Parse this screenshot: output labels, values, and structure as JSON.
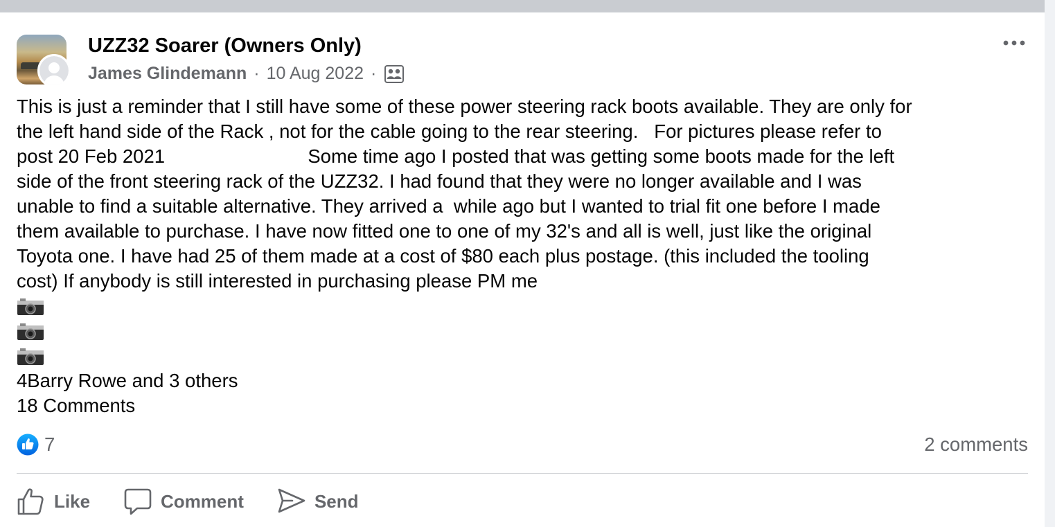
{
  "post": {
    "group_name": "UZZ32 Soarer (Owners Only)",
    "author": "James Glindemann",
    "separator": "·",
    "date": "10 Aug 2022",
    "audience_icon": "group-members-icon",
    "more_icon": "more-options-icon",
    "body": "This is just a reminder that I still have some of these power steering rack boots available. They are only for\nthe left hand side of the Rack , not for the cable going to the rear steering.   For pictures please refer to\npost 20 Feb 2021                           Some time ago I posted that was getting some boots made for the left\nside of the front steering rack of the UZZ32. I had found that they were no longer available and I was\nunable to find a suitable alternative. They arrived a  while ago but I wanted to trial fit one before I made\nthem available to purchase. I have now fitted one to one of my 32's and all is well, just like the original\nToyota one. I have had 25 of them made at a cost of $80 each plus postage. (this included the tooling\ncost) If anybody is still interested in purchasing please PM me",
    "camera_icons": [
      "camera-icon",
      "camera-icon",
      "camera-icon"
    ],
    "likers": "4Barry Rowe and 3 others",
    "comments_line": "18 Comments"
  },
  "stats": {
    "like_count": "7",
    "comments_count": "2 comments"
  },
  "actions": {
    "like_label": "Like",
    "comment_label": "Comment",
    "send_label": "Send"
  },
  "colors": {
    "secondary_text": "#65676b",
    "like_blue": "#1877f2",
    "divider": "#ced0d4",
    "top_strip": "#c9ccd1"
  }
}
